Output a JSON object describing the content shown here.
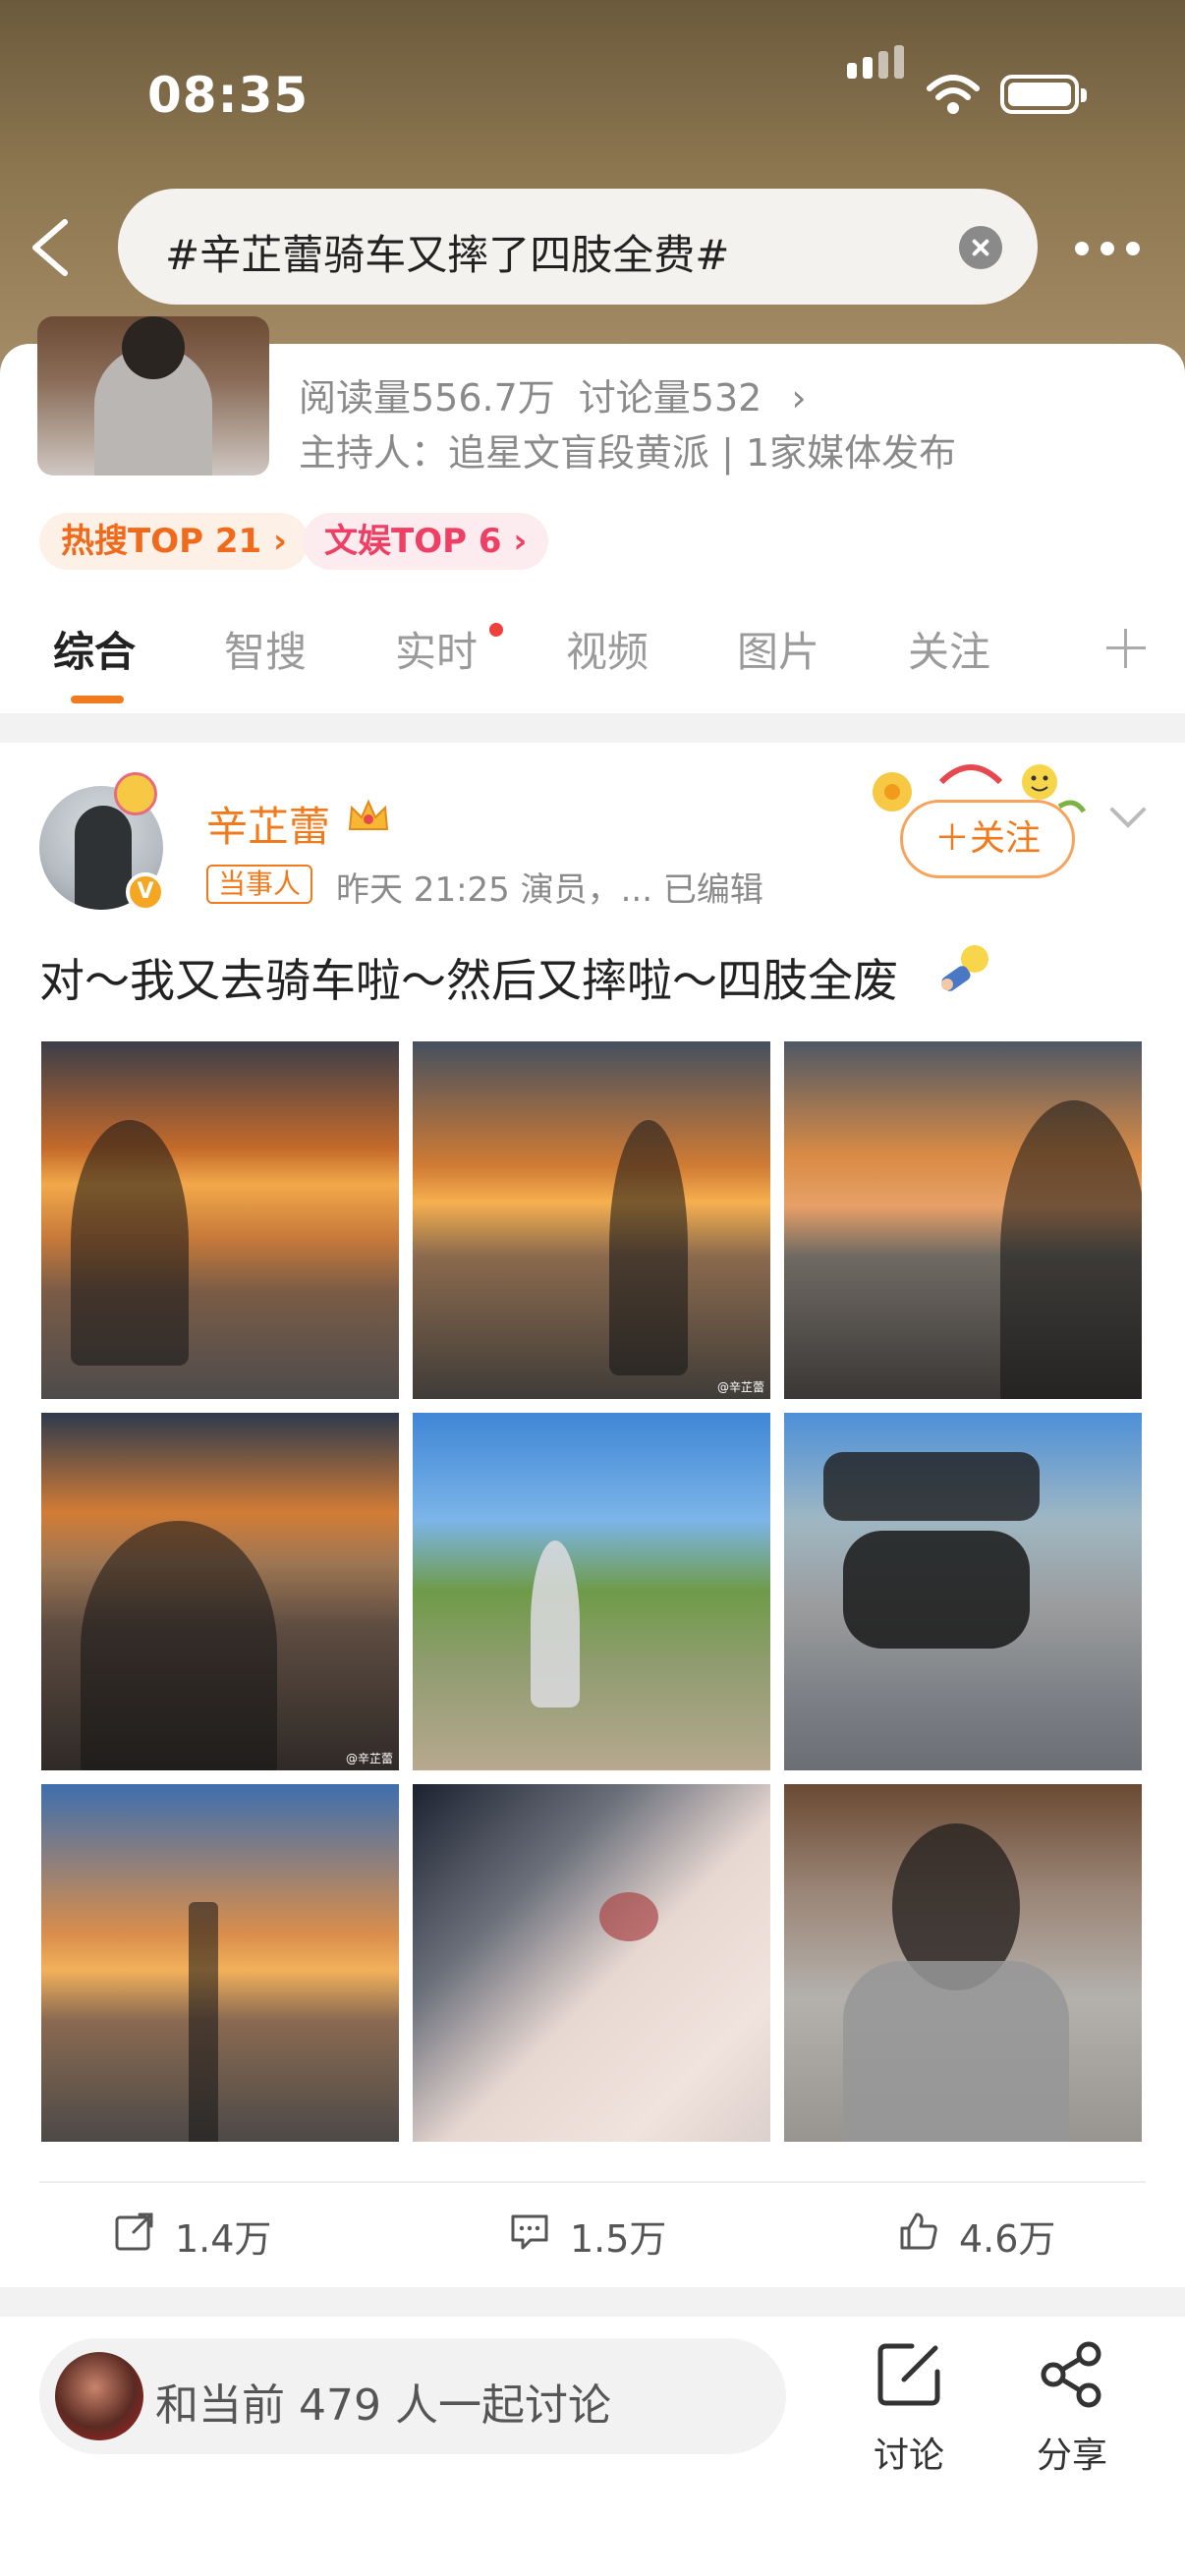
{
  "status_bar": {
    "time": "08:35"
  },
  "search": {
    "query": "#辛芷蕾骑车又摔了四肢全费#"
  },
  "topic": {
    "stats": {
      "reads": "阅读量556.7万",
      "discussions": "讨论量532"
    },
    "host": "主持人：追星文盲段黄派 | 1家媒体发布",
    "badges": [
      {
        "label": "热搜TOP 21 ›"
      },
      {
        "label": "文娱TOP 6 ›"
      }
    ]
  },
  "tabs": [
    {
      "label": "综合",
      "active": true
    },
    {
      "label": "智搜"
    },
    {
      "label": "实时",
      "has_dot": true
    },
    {
      "label": "视频"
    },
    {
      "label": "图片"
    },
    {
      "label": "关注"
    }
  ],
  "post": {
    "username": "辛芷蕾",
    "role_tag": "当事人",
    "meta": "昨天 21:25   演员，...  已编辑",
    "follow_label": "＋关注",
    "text": "对～我又去骑车啦～然后又摔啦～四肢全废",
    "watermark": "@辛芷蕾",
    "actions": {
      "share": "1.4万",
      "comment": "1.5万",
      "like": "4.6万"
    }
  },
  "bottom_bar": {
    "discuss_placeholder": "和当前 479 人一起讨论",
    "discuss_label": "讨论",
    "share_label": "分享"
  },
  "colors": {
    "accent": "#f07a1c",
    "hot_badge": "#f06a1c",
    "ent_badge": "#ee3f64"
  }
}
